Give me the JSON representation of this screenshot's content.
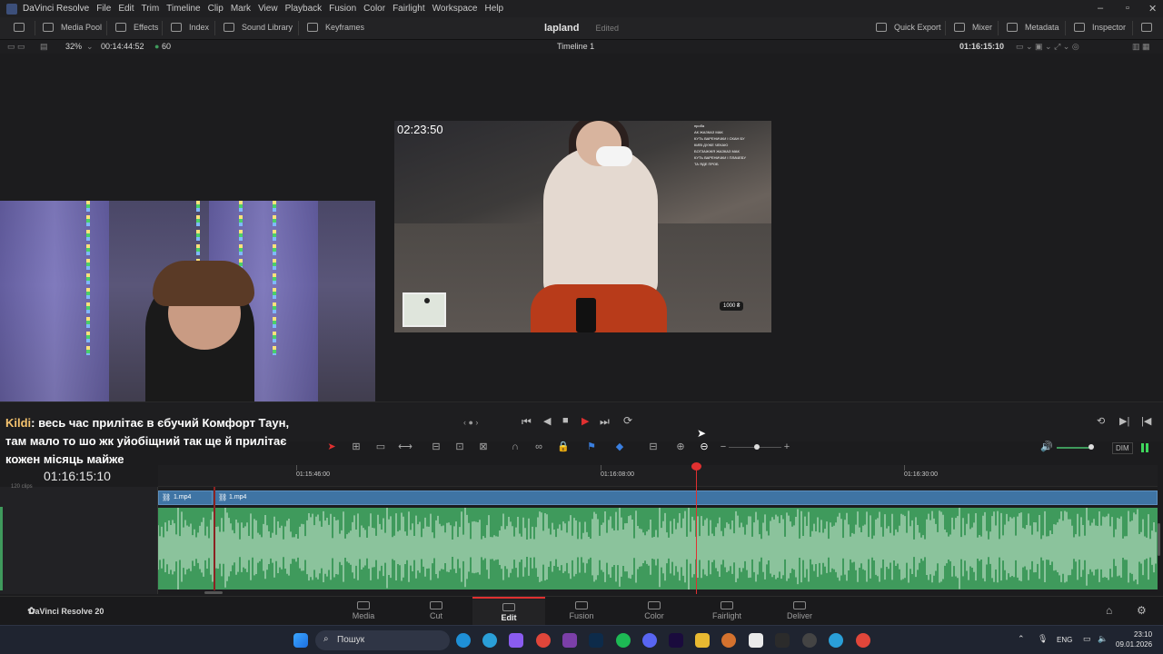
{
  "titlebar": {
    "app_title": "DaVinci Resolve",
    "menu": [
      "File",
      "Edit",
      "Trim",
      "Timeline",
      "Clip",
      "Mark",
      "View",
      "Playback",
      "Fusion",
      "Color",
      "Fairlight",
      "Workspace",
      "Help"
    ]
  },
  "toolbar": {
    "media_pool": "Media Pool",
    "effects": "Effects",
    "index": "Index",
    "sound_library": "Sound Library",
    "keyframes": "Keyframes",
    "project_title": "lapland",
    "project_status": "Edited",
    "quick_export": "Quick Export",
    "mixer": "Mixer",
    "metadata": "Metadata",
    "inspector": "Inspector"
  },
  "viewer": {
    "zoom": "32%",
    "source_timecode": "00:14:44:52",
    "fps": "60",
    "timeline_name": "Timeline 1",
    "record_timecode": "01:16:15:10",
    "video_timecode": "02:23:50",
    "donation": "1000 ₴",
    "chat_lines": [
      "проба",
      "АК ЖАЗКАЗ МАК",
      "КУТЬ ВАРЕНИЧКИ І СКАН БУ",
      "КИЇВ ДУЖЕ ЧЕКАЮ",
      "БОГЗАЖЖЯ ЖАЗКАЗ МАК",
      "КУТЬ ВАРЕНИЧКИ І ПЛАЧЕБУ",
      "ТА ЯДЕ ПРОБ"
    ]
  },
  "subtitle": {
    "speaker": "Kildi",
    "text": ": весь час прилітає в єбучий Комфорт Таун, там мало то шо жк уйобіщний так ще й прилітає кожен місяць майже"
  },
  "timeline": {
    "timecode": "01:16:15:10",
    "ruler": [
      "01:15:46:00",
      "01:16:08:00",
      "01:16:30:00"
    ],
    "clips": [
      "1.mp4",
      "1.mp4"
    ],
    "track_small_label": "120 clips",
    "dim_label": "DIM",
    "volume_level": 0.8
  },
  "pages": [
    {
      "label": "Media",
      "icon": "media-icon"
    },
    {
      "label": "Cut",
      "icon": "cut-icon"
    },
    {
      "label": "Edit",
      "icon": "edit-icon"
    },
    {
      "label": "Fusion",
      "icon": "fusion-icon"
    },
    {
      "label": "Color",
      "icon": "color-icon"
    },
    {
      "label": "Fairlight",
      "icon": "fairlight-icon"
    },
    {
      "label": "Deliver",
      "icon": "deliver-icon"
    }
  ],
  "active_page": "Edit",
  "brand": "DaVinci Resolve 20",
  "taskbar": {
    "search_placeholder": "Пошук",
    "language": "ENG",
    "time": "23:10",
    "date": "09.01.2026"
  },
  "colors": {
    "accent_red": "#e03030",
    "video_track": "#3f74a4",
    "audio_track": "#3f9a5c"
  }
}
